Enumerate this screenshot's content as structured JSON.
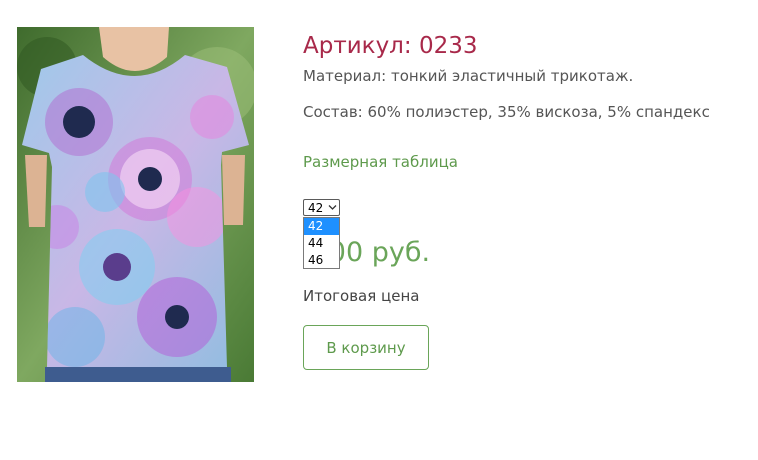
{
  "product": {
    "title": "Артикул: 0233",
    "material": "Материал: тонкий эластичный трикотаж.",
    "composition": "Состав: 60% полиэстер, 35% вискоза, 5% спандекс",
    "size_table_link": "Размерная таблица",
    "size_select": {
      "value": "42",
      "options": [
        "42",
        "44",
        "46"
      ],
      "highlighted": "42"
    },
    "price_visible": "0,00 руб.",
    "total_label": "Итоговая цена",
    "cart_button": "В корзину"
  },
  "colors": {
    "title": "#a8294a",
    "accent_green": "#5e9a4c",
    "price": "#6aa559",
    "dropdown_highlight": "#1e90ff"
  }
}
